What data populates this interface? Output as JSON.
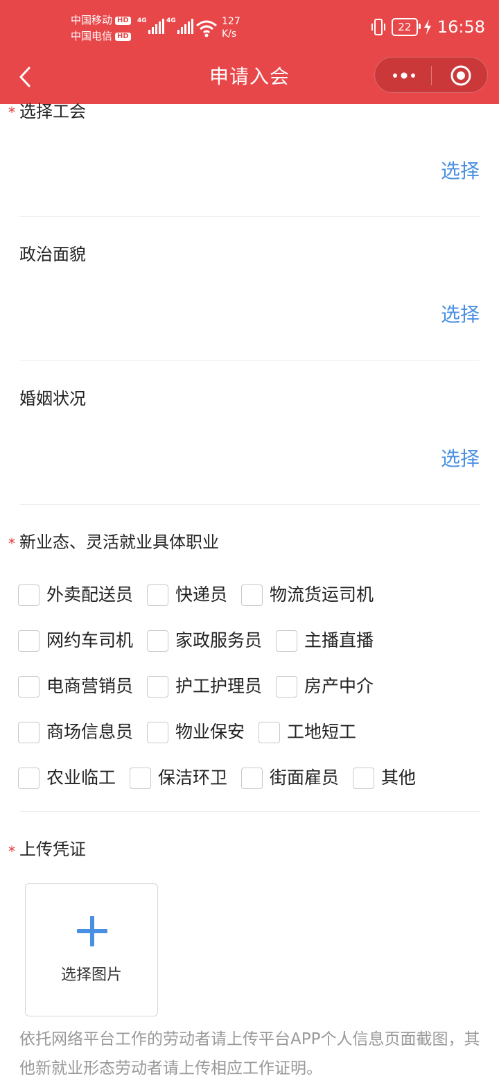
{
  "status_bar": {
    "carrier1": "中国移动",
    "carrier2": "中国电信",
    "hd": "HD",
    "net1": "4G",
    "net2": "4G",
    "speed_value": "127",
    "speed_unit": "K/s",
    "battery": "22",
    "time": "16:58"
  },
  "nav": {
    "title": "申请入会"
  },
  "form": {
    "union": {
      "label": "选择工会",
      "action": "选择"
    },
    "political": {
      "label": "政治面貌",
      "action": "选择"
    },
    "marital": {
      "label": "婚姻状况",
      "action": "选择"
    },
    "occupation": {
      "label": "新业态、灵活就业具体职业",
      "rows": [
        [
          "外卖配送员",
          "快递员",
          "物流货运司机"
        ],
        [
          "网约车司机",
          "家政服务员",
          "主播直播"
        ],
        [
          "电商营销员",
          "护工护理员",
          "房产中介"
        ],
        [
          "商场信息员",
          "物业保安",
          "工地短工"
        ],
        [
          "农业临工",
          "保洁环卫",
          "街面雇员",
          "其他"
        ]
      ]
    },
    "upload": {
      "label": "上传凭证",
      "button": "选择图片",
      "note": "依托网络平台工作的劳动者请上传平台APP个人信息页面截图，其他新就业形态劳动者请上传相应工作证明。"
    }
  },
  "colors": {
    "header": "#e8474a",
    "link": "#4a90e2",
    "required": "#e33b3b"
  }
}
